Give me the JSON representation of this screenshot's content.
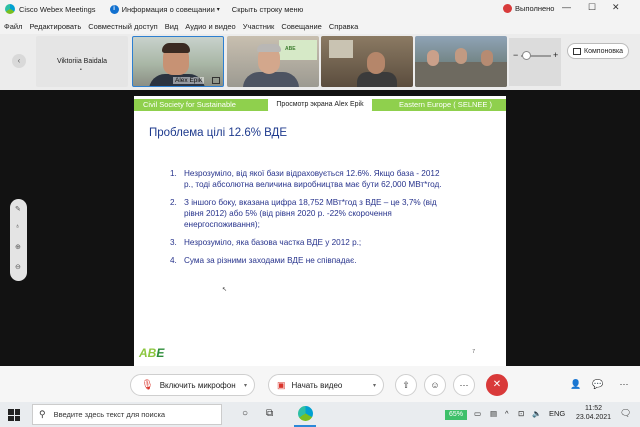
{
  "titlebar": {
    "app_title": "Cisco Webex Meetings",
    "meeting_info": "Информация о совещании",
    "hide_menu": "Скрыть строку меню",
    "recording": "Выполнено",
    "minimize": "—",
    "maximize": "☐",
    "close": "✕"
  },
  "menubar": [
    "Файл",
    "Редактировать",
    "Совместный доступ",
    "Вид",
    "Аудио и видео",
    "Участник",
    "Совещание",
    "Справка"
  ],
  "participants": {
    "name_tile": "Viktoriia Baidala",
    "name_tile_sub": "•",
    "active_speaker": "Alex Epik",
    "wall_logo": "ABE"
  },
  "layout_button": "Компоновка",
  "share_label": "Просмотр экрана Alex Epik",
  "slide": {
    "banner_left": "Civil Society for Sustainable",
    "banner_right": "Eastern Europe ( SELNEE )",
    "title": "Проблема цілі 12.6% ВДЕ",
    "items": [
      {
        "num": "1.",
        "text": "Незрозуміло, від якої бази відраховується 12.6%. Якщо база - 2012 р., тоді абсолютна величина виробництва має бути 62,000 МВт*год."
      },
      {
        "num": "2.",
        "text": "З іншого боку, вказана цифра 18,752 МВт*год з ВДЕ – це 3,7% (від рівня 2012) або 5% (від рівня 2020 р. -22% скорочення енергоспоживання);"
      },
      {
        "num": "3.",
        "text": "Незрозуміло, яка базова частка ВДЕ у 2012 р.;"
      },
      {
        "num": "4.",
        "text": "Сума за різними заходами ВДЕ не співпадає."
      }
    ],
    "logo_a": "AB",
    "logo_b": "E",
    "page_number": "7"
  },
  "controls": {
    "mic_label": "Включить микрофон",
    "video_label": "Начать видео"
  },
  "taskbar": {
    "search_placeholder": "Введите здесь текст для поиска",
    "battery": "65%",
    "language": "ENG",
    "time": "11:52",
    "date": "23.04.2021"
  }
}
